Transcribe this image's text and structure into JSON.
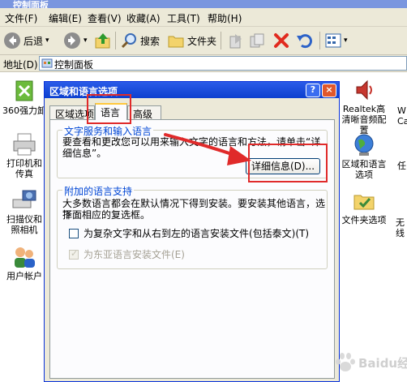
{
  "window": {
    "title": "控制面板"
  },
  "menu": [
    "文件(F)",
    "编辑(E)",
    "查看(V)",
    "收藏(A)",
    "工具(T)",
    "帮助(H)"
  ],
  "toolbar": {
    "back_label": "后退",
    "search_label": "搜索",
    "folders_label": "文件夹"
  },
  "address": {
    "label": "地址(D)",
    "value": "控制面板"
  },
  "icons": {
    "left": [
      {
        "label": "360强力卸"
      },
      {
        "label": "打印机和传真"
      },
      {
        "label": "扫描仪和照相机"
      },
      {
        "label": "用户帐户"
      }
    ],
    "right": [
      {
        "label": "Realtek高清晰音频配置"
      },
      {
        "label": "区域和语言选项"
      },
      {
        "label": "文件夹选项"
      }
    ],
    "edge": [
      "W",
      "Ca",
      "任",
      "无线"
    ]
  },
  "dialog": {
    "title": "区域和语言选项",
    "help_glyph": "?",
    "close_glyph": "×",
    "tabs": [
      "区域选项",
      "语言",
      "高级"
    ],
    "active_tab": 1,
    "group1": {
      "title": "文字服务和输入语言",
      "text": "要查看和更改您可以用来输入文字的语言和方法，请单击“详细信息”。",
      "details_button": "详细信息(D)..."
    },
    "group2": {
      "title": "附加的语言支持",
      "text_line1": "大多数语言都会在默认情况下得到安装。要安装其他语言，选择",
      "text_line2": "下面相应的复选框。",
      "checkbox1": {
        "label": "为复杂文字和从右到左的语言安装文件(包括泰文)(T)",
        "checked": false,
        "enabled": true
      },
      "checkbox2": {
        "label": "为东亚语言安装文件(E)",
        "checked": true,
        "enabled": false
      }
    }
  },
  "watermark": {
    "text": "Baidu经验"
  },
  "colors": {
    "annotation_red": "#e02a2a",
    "title_blue": "#0c3fcf"
  }
}
